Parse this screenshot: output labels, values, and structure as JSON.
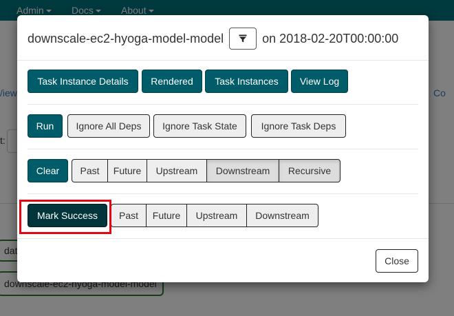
{
  "navbar": {
    "items": [
      "Admin",
      "Docs",
      "About"
    ],
    "bg_color": "#00727d"
  },
  "background_page": {
    "left_link_fragment": "/iew",
    "right_link_fragment": "Co",
    "label_fragment": "t:",
    "node_partial": "dat",
    "node_label": "downscale-ec2-hyoga-model-model"
  },
  "modal": {
    "task_id": "downscale-ec2-hyoga-model-model",
    "filter_icon": "filter-icon",
    "on_text": "on 2018-02-20T00:00:00",
    "row1": [
      "Task Instance Details",
      "Rendered",
      "Task Instances",
      "View Log"
    ],
    "run": {
      "label": "Run",
      "options": [
        "Ignore All Deps",
        "Ignore Task State",
        "Ignore Task Deps"
      ]
    },
    "clear": {
      "label": "Clear",
      "options": [
        "Past",
        "Future",
        "Upstream",
        "Downstream",
        "Recursive"
      ],
      "active": [
        "Downstream",
        "Recursive"
      ]
    },
    "mark_success": {
      "label": "Mark Success",
      "options": [
        "Past",
        "Future",
        "Upstream",
        "Downstream"
      ]
    },
    "close_label": "Close"
  },
  "colors": {
    "primary": "#005c68",
    "dark": "#00363b",
    "highlight": "#e30613"
  }
}
